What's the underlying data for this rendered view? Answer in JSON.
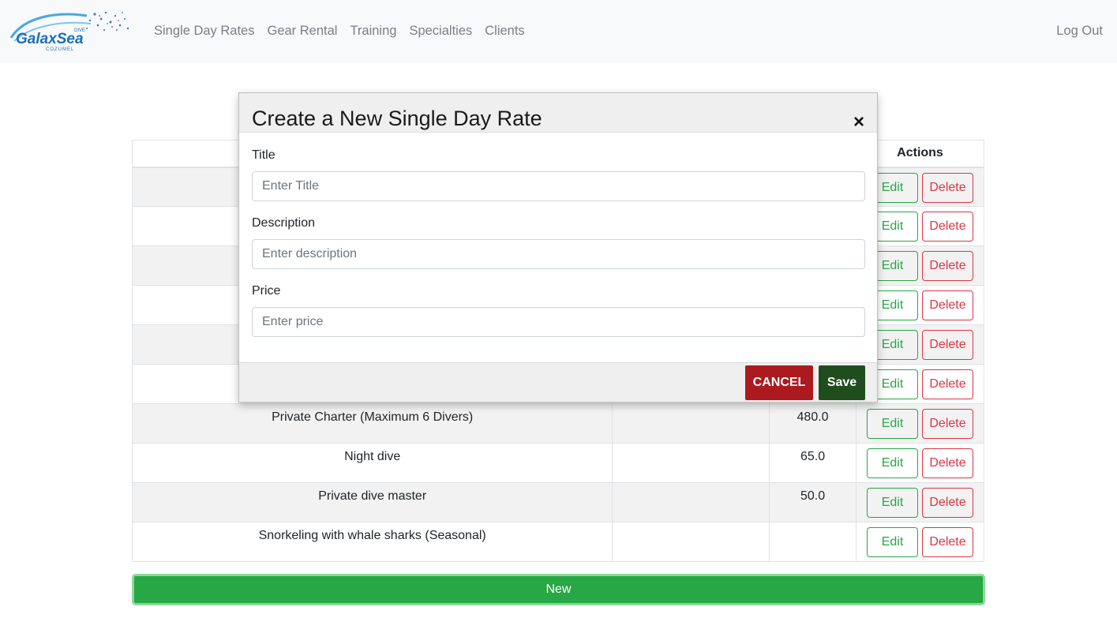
{
  "nav": {
    "brand_text": "GalaxSea",
    "brand_sub": "COZUMEL",
    "brand_tag": "DIVE",
    "links": [
      "Single Day Rates",
      "Gear Rental",
      "Training",
      "Specialties",
      "Clients"
    ],
    "logout": "Log Out"
  },
  "table": {
    "headers": [
      "",
      "",
      "",
      "Actions"
    ],
    "rows": [
      {
        "title": "",
        "description": "",
        "price": ""
      },
      {
        "title": "",
        "description": "",
        "price": ""
      },
      {
        "title": "",
        "description": "",
        "price": ""
      },
      {
        "title": "",
        "description": "",
        "price": ""
      },
      {
        "title": "",
        "description": "",
        "price": ""
      },
      {
        "title": "",
        "description": "",
        "price": ""
      },
      {
        "title": "Private Charter (Maximum 6 Divers)",
        "description": "",
        "price": "480.0"
      },
      {
        "title": "Night dive",
        "description": "",
        "price": "65.0"
      },
      {
        "title": "Private dive master",
        "description": "",
        "price": "50.0"
      },
      {
        "title": "Snorkeling with whale sharks (Seasonal)",
        "description": "",
        "price": ""
      }
    ],
    "edit_label": "Edit",
    "delete_label": "Delete"
  },
  "new_button": "New",
  "modal": {
    "title": "Create a New Single Day Rate",
    "close": "×",
    "fields": {
      "title": {
        "label": "Title",
        "placeholder": "Enter Title",
        "value": ""
      },
      "description": {
        "label": "Description",
        "placeholder": "Enter description",
        "value": ""
      },
      "price": {
        "label": "Price",
        "placeholder": "Enter price",
        "value": ""
      }
    },
    "cancel_label": "CANCEL",
    "save_label": "Save"
  },
  "colors": {
    "success": "#28a745",
    "danger": "#dc3545",
    "cancel": "#ab1a1f",
    "save": "#1f4d1d",
    "brand": "#1c6fb5"
  }
}
